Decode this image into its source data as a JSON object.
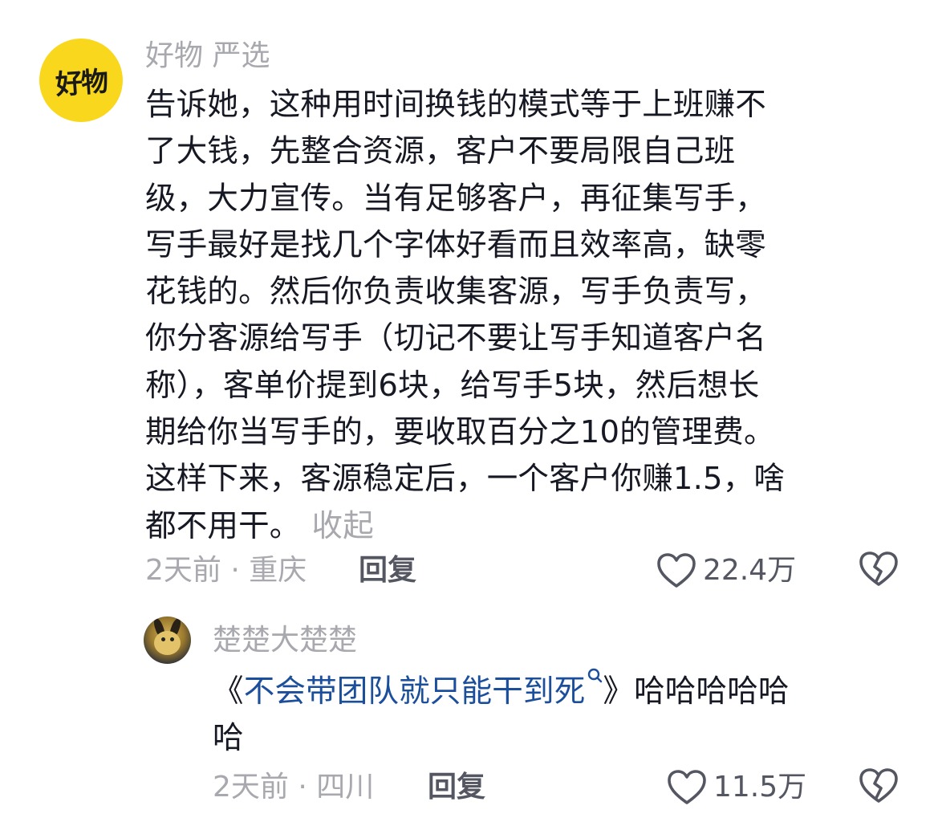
{
  "comment_main": {
    "avatar_text": "好物",
    "username": "好物 严选",
    "body_lines": [
      "告诉她，这种用时间换钱的模式等于上班赚不",
      "了大钱，先整合资源，客户不要局限自己班",
      "级，大力宣传。当有足够客户，再征集写手，",
      "写手最好是找几个字体好看而且效率高，缺零",
      "花钱的。然后你负责收集客源，写手负责写，",
      "你分客源给写手（切记不要让写手知道客户名",
      "称），客单价提到6块，给写手5块，然后想长",
      "期给你当写手的，要收取百分之10的管理费。",
      "这样下来，客源稳定后，一个客户你赚1.5，啥",
      "都不用干。"
    ],
    "collapse_label": "收起",
    "time_location": "2天前 · 重庆",
    "reply_label": "回复",
    "like_count": "22.4万"
  },
  "comment_reply": {
    "username": "楚楚大楚楚",
    "body_prefix": "《",
    "topic_link": "不会带团队就只能干到死",
    "body_suffix_line1": "》哈哈哈哈哈",
    "body_line2": "哈",
    "time_location": "2天前 · 四川",
    "reply_label": "回复",
    "like_count": "11.5万"
  },
  "colors": {
    "text_primary": "#161823",
    "text_secondary": "#a8a9ae",
    "text_action": "#545762",
    "link": "#1c4f9b",
    "avatar_bg": "#f9d71c"
  },
  "icons": {
    "like": "heart-outline-icon",
    "dislike": "broken-heart-icon",
    "search": "search-icon"
  }
}
